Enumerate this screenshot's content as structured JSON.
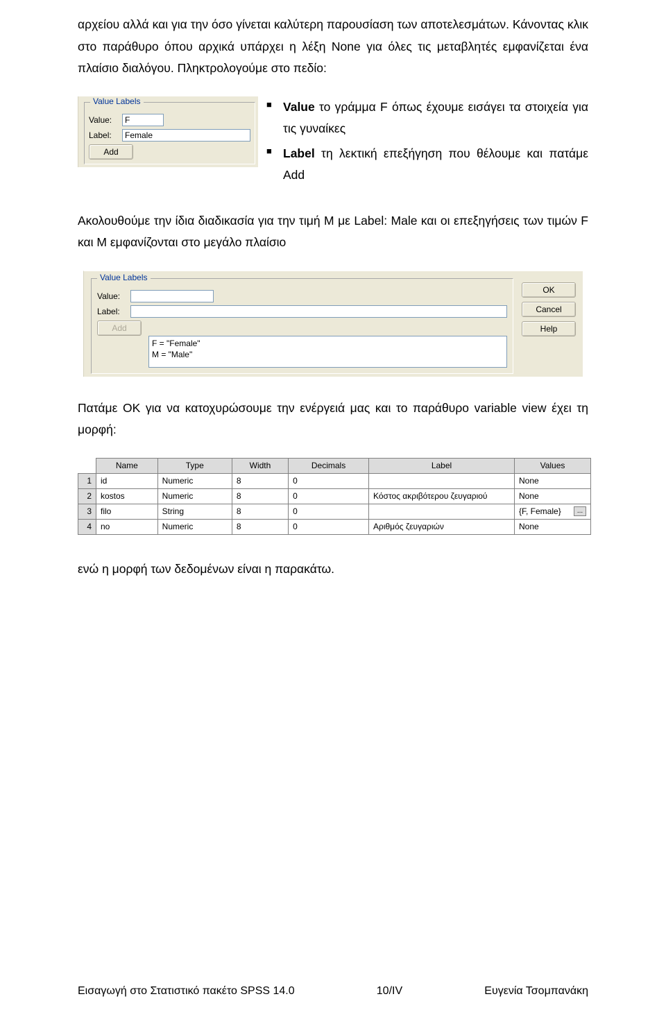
{
  "para1": "αρχείου αλλά και για την όσο γίνεται καλύτερη παρουσίαση των αποτελεσμάτων. Κάνοντας κλικ στο παράθυρο όπου αρχικά υπάρχει η λέξη None για όλες τις μεταβλητές εμφανίζεται ένα πλαίσιο διαλόγου. Πληκτρολογούμε στο πεδίο:",
  "ss1": {
    "group_title": "Value Labels",
    "value_lbl": "Value:",
    "label_lbl": "Label:",
    "value_val": "F",
    "label_val": "Female",
    "add_btn": "Add"
  },
  "bullets": [
    {
      "pre": "Value",
      "post": " το γράμμα F όπως έχουμε εισάγει τα στοιχεία για τις γυναίκες"
    },
    {
      "pre": "Label",
      "post": " τη λεκτική επεξήγηση που θέλουμε και πατάμε Add"
    }
  ],
  "para2": "Ακολουθούμε την ίδια διαδικασία για την τιμή M με Label: Male   και οι επεξηγήσεις των τιμών F και M εμφανίζονται στο μεγάλο πλαίσιο",
  "ss2": {
    "group_title": "Value Labels",
    "value_lbl": "Value:",
    "label_lbl": "Label:",
    "value_val": "",
    "label_val": "",
    "add_btn": "Add",
    "list": [
      "F = \"Female\"",
      "M = \"Male\""
    ],
    "ok": "OK",
    "cancel": "Cancel",
    "help": "Help"
  },
  "para3": "Πατάμε ΟΚ για να  κατοχυρώσουμε την ενέργειά μας και το παράθυρο variable view έχει τη μορφή:",
  "table": {
    "headers": [
      "Name",
      "Type",
      "Width",
      "Decimals",
      "Label",
      "Values"
    ],
    "rows": [
      {
        "n": "1",
        "name": "id",
        "type": "Numeric",
        "width": "8",
        "dec": "0",
        "label": "",
        "values": "None"
      },
      {
        "n": "2",
        "name": "kostos",
        "type": "Numeric",
        "width": "8",
        "dec": "0",
        "label": "Κόστος ακριβότερου ζευγαριού",
        "values": "None"
      },
      {
        "n": "3",
        "name": "filo",
        "type": "String",
        "width": "8",
        "dec": "0",
        "label": "",
        "values": "{F, Female}"
      },
      {
        "n": "4",
        "name": "no",
        "type": "Numeric",
        "width": "8",
        "dec": "0",
        "label": "Αριθμός ζευγαριών",
        "values": "None"
      }
    ],
    "ellipsis": "..."
  },
  "para4": "ενώ η μορφή των δεδομένων είναι η παρακάτω.",
  "footer": {
    "left": "Εισαγωγή στο Στατιστικό πακέτο SPSS 14.0",
    "center": "10/IV",
    "right": "Ευγενία Τσομπανάκη"
  }
}
